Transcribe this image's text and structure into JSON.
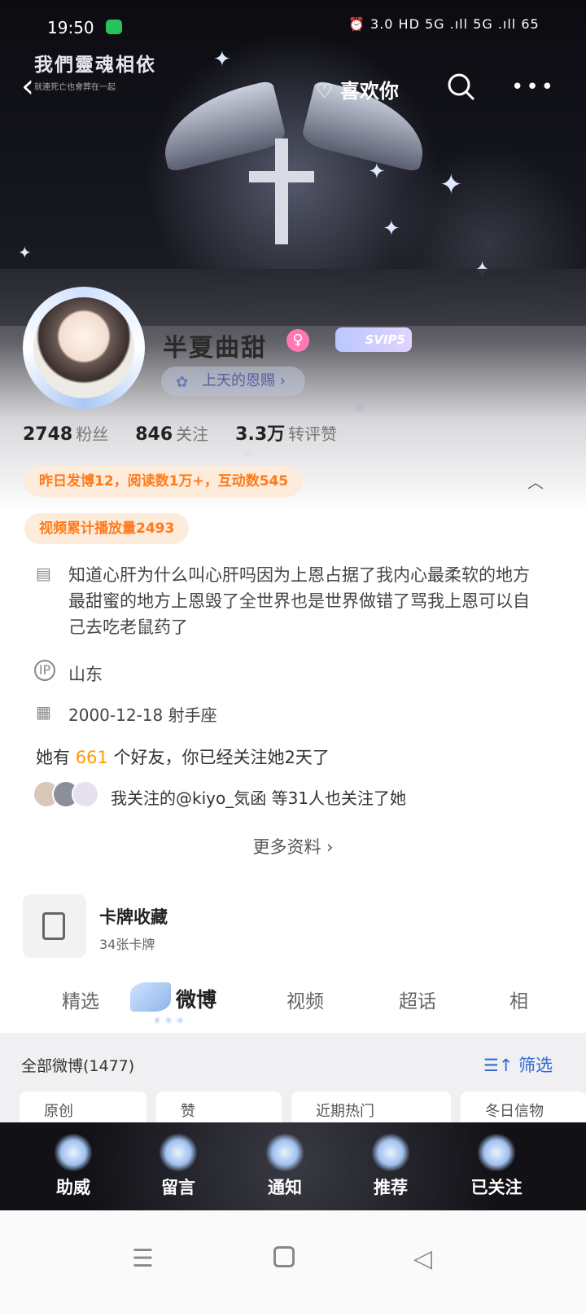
{
  "status_bar": {
    "time": "19:50",
    "right_text": "⏰ 3.0 HD 5G .ıll 5G .ıll 65"
  },
  "header": {
    "banner_title": "我們靈魂相依",
    "banner_subtitle": "就連死亡也會葬在一起",
    "like_label": "喜欢你"
  },
  "profile": {
    "name": "半夏曲甜",
    "vip_label": "SVIP5",
    "tag_label": "上天的恩赐",
    "stats": [
      {
        "value": "2748",
        "label": "粉丝"
      },
      {
        "value": "846",
        "label": "关注"
      },
      {
        "value": "3.3万",
        "label": "转评赞"
      }
    ],
    "yesterday_stats": "昨日发博12，阅读数1万+，互动数545",
    "video_stats": "视频累计播放量2493",
    "bio": "知道心肝为什么叫心肝吗因为上恩占据了我内心最柔软的地方最甜蜜的地方上恩毁了全世界也是世界做错了骂我上恩可以自己去吃老鼠药了",
    "location": "山东",
    "birthday": "2000-12-18 射手座",
    "friends_prefix": "她有",
    "friends_count": "661",
    "friends_suffix": "个好友，你已经关注她2天了",
    "mutual_follow": "我关注的@kiyo_気函 等31人也关注了她",
    "more_info": "更多资料 ›"
  },
  "cards": {
    "title": "卡牌收藏",
    "subtitle": "34张卡牌"
  },
  "tabs": [
    {
      "label": "精选"
    },
    {
      "label": "微博"
    },
    {
      "label": "视频"
    },
    {
      "label": "超话"
    },
    {
      "label": "相"
    }
  ],
  "feed": {
    "title": "全部微博(1477)",
    "filter_label": "筛选",
    "chips": [
      {
        "label": "原创"
      },
      {
        "label": "赞"
      },
      {
        "label": "近期热门"
      },
      {
        "label": "冬日信物"
      }
    ]
  },
  "bottom_nav": [
    {
      "label": "助威",
      "icon": "phoenix-icon"
    },
    {
      "label": "留言",
      "icon": "wing-icon"
    },
    {
      "label": "通知",
      "icon": "star-icon"
    },
    {
      "label": "推荐",
      "icon": "butterfly-icon"
    },
    {
      "label": "已关注",
      "icon": "castle-icon"
    }
  ],
  "colors": {
    "accent_orange": "#ff7a1a",
    "link_blue": "#2c6ad4",
    "banner_dark": "#111116"
  }
}
